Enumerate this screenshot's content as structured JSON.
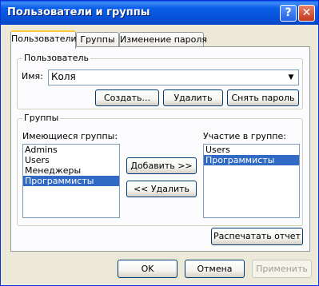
{
  "window": {
    "title": "Пользователи и группы",
    "help_glyph": "?",
    "close_glyph": "✕"
  },
  "tabs": [
    {
      "label": "Пользователи",
      "active": true
    },
    {
      "label": "Группы",
      "active": false
    },
    {
      "label": "Изменение пароля",
      "active": false
    }
  ],
  "user_group": {
    "legend": "Пользователь",
    "name_label": "Имя:",
    "name_value": "Коля",
    "combo_arrow": "▼",
    "create_button": "Создать...",
    "delete_button": "Удалить",
    "remove_password_button": "Снять пароль"
  },
  "groups_group": {
    "legend": "Группы",
    "available_label": "Имеющиеся группы:",
    "available_items": [
      {
        "label": "Admins",
        "selected": false
      },
      {
        "label": "Users",
        "selected": false
      },
      {
        "label": "Менеджеры",
        "selected": false
      },
      {
        "label": "Программисты",
        "selected": true
      }
    ],
    "add_button": "Добавить >>",
    "remove_button": "<< Удалить",
    "member_label": "Участие в группе:",
    "member_items": [
      {
        "label": "Users",
        "selected": false
      },
      {
        "label": "Программисты",
        "selected": true
      }
    ]
  },
  "print_report_button": "Распечатать отчет",
  "footer": {
    "ok_button": "OK",
    "cancel_button": "Отмена",
    "apply_button": "Применить",
    "apply_enabled": false
  },
  "colors": {
    "titlebar": "#0a5ee8",
    "selection": "#316ac5",
    "dialog_background": "#ece9d8",
    "active_tab_highlight": "#ffc83c"
  }
}
